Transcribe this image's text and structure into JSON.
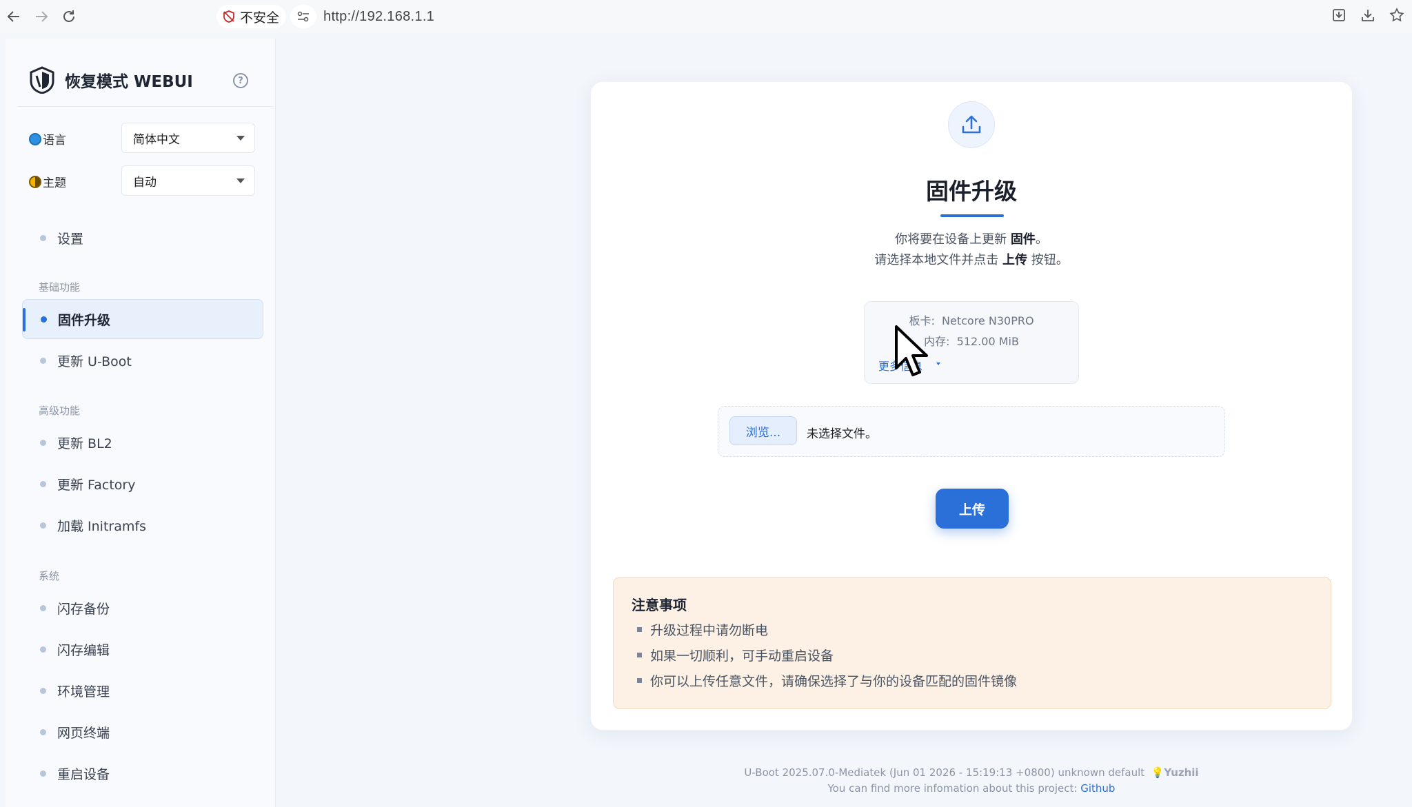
{
  "browser": {
    "security_label": "不安全",
    "url": "http://192.168.1.1"
  },
  "sidebar": {
    "brand": "恢复模式 WEBUI",
    "language_label": "语言",
    "language_value": "简体中文",
    "theme_label": "主题",
    "theme_value": "自动",
    "settings": "设置",
    "sections": {
      "basic": "基础功能",
      "advanced": "高级功能",
      "system": "系统"
    },
    "items": {
      "firmware_upgrade": "固件升级",
      "update_uboot": "更新 U-Boot",
      "update_bl2": "更新 BL2",
      "update_factory": "更新 Factory",
      "load_initramfs": "加载 Initramfs",
      "flash_backup": "闪存备份",
      "flash_edit": "闪存编辑",
      "env_manage": "环境管理",
      "web_terminal": "网页终端",
      "reboot": "重启设备"
    }
  },
  "main": {
    "title": "固件升级",
    "desc1_pre": "你将要在设备上更新 ",
    "desc1_bold": "固件",
    "desc1_post": "。",
    "desc2_pre": "请选择本地文件并点击 ",
    "desc2_bold": "上传",
    "desc2_post": " 按钮。",
    "board_label": "板卡:",
    "board_value": "Netcore N30PRO",
    "memory_label": "内存:",
    "memory_value": "512.00 MiB",
    "more_info": "更多信息",
    "browse_label": "浏览...",
    "file_status": "未选择文件。",
    "upload_label": "上传",
    "notice_title": "注意事项",
    "notices": [
      "升级过程中请勿断电",
      "如果一切顺利，可手动重启设备",
      "你可以上传任意文件，请确保选择了与你的设备匹配的固件镜像"
    ]
  },
  "footer": {
    "version": "U-Boot 2025.07.0-Mediatek (Jun 01 2026 - 15:19:13 +0800) unknown default",
    "author": "Yuzhii",
    "info_text": "You can find more infomation about this project:",
    "link": "Github"
  },
  "colors": {
    "accent": "#2b6fd8",
    "notice_bg": "#fcf1e4"
  }
}
